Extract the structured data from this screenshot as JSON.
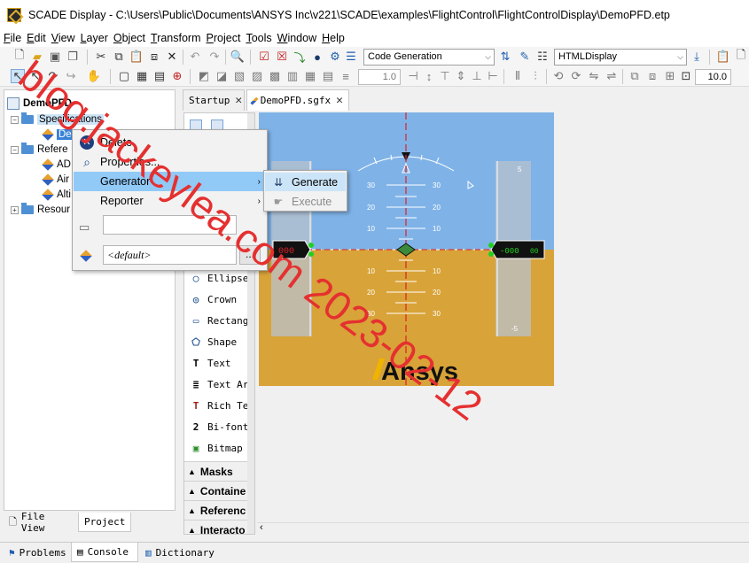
{
  "window": {
    "title": "SCADE Display - C:\\Users\\Public\\Documents\\ANSYS Inc\\v221\\SCADE\\examples\\FlightControl\\FlightControlDisplay\\DemoPFD.etp"
  },
  "menubar": [
    "File",
    "Edit",
    "View",
    "Layer",
    "Object",
    "Transform",
    "Project",
    "Tools",
    "Window",
    "Help"
  ],
  "toolbar": {
    "config_combo": "Code Generation",
    "target_combo": "HTMLDisplay",
    "line_width": "1.0",
    "zoom_value": "10.0"
  },
  "tree": {
    "root": "DemoPFD",
    "specifications": "Specifications",
    "spec_child": "Dem",
    "references": "Refere",
    "ref_children": [
      "AD",
      "Air",
      "Alti"
    ],
    "resources": "Resour"
  },
  "left_tabs": [
    "File View",
    "Project"
  ],
  "editor_tabs": [
    "Startup",
    "DemoPFD.sgfx"
  ],
  "palette": {
    "items": [
      "Ellipse",
      "Crown",
      "Rectang",
      "Shape",
      "Text",
      "Text Ar",
      "Rich Te",
      "Bi-font",
      "Bitmap"
    ],
    "groups": [
      "Masks",
      "Containe",
      "Referenc",
      "Interacto"
    ]
  },
  "context_menu": {
    "items": [
      "Delete",
      "Properties...",
      "Generator",
      "Reporter"
    ],
    "config_field": "<default>",
    "browse_button": "..."
  },
  "generator_submenu": {
    "items": [
      "Generate",
      "Execute"
    ]
  },
  "pfd": {
    "pitch_labels_left": [
      "30",
      "20",
      "10",
      "10",
      "20",
      "30"
    ],
    "pitch_labels_right": [
      "30",
      "20",
      "10",
      "10",
      "20",
      "30"
    ],
    "speed_readout": "000",
    "altitude_readout": "-000",
    "altitude_readout_small": "00",
    "vs_labels": [
      "5",
      "-5"
    ],
    "brand": "Ansys",
    "colors": {
      "sky": "#7fb3e8",
      "ground": "#d8a338",
      "tape": "#b8c2cc",
      "accent": "#f0b400"
    }
  },
  "bottom_tabs": [
    "Problems",
    "Console",
    "Dictionary"
  ],
  "watermark": "blog.jackeylea.com 2023-02-12"
}
